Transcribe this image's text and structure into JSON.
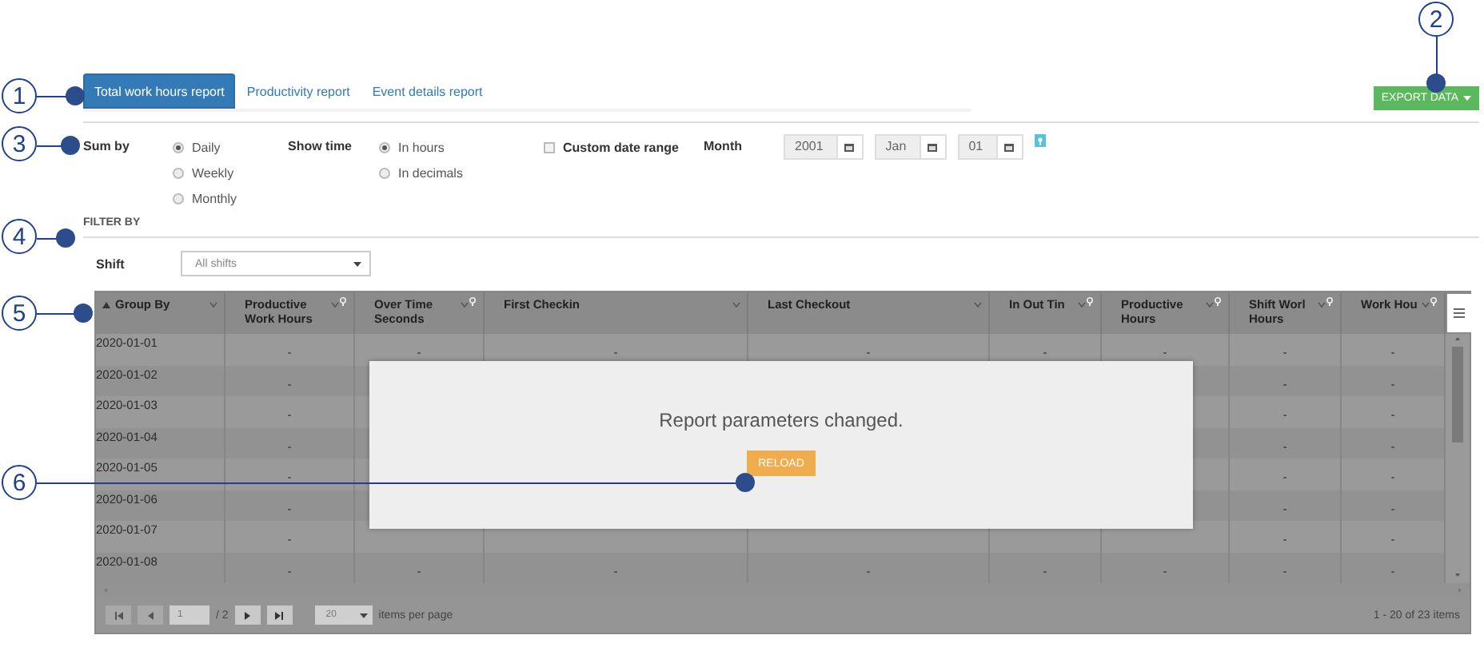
{
  "callouts": [
    {
      "label": "1"
    },
    {
      "label": "2"
    },
    {
      "label": "3"
    },
    {
      "label": "4"
    },
    {
      "label": "5"
    },
    {
      "label": "6"
    }
  ],
  "tabs": [
    {
      "label": "Total work hours report",
      "selected": true
    },
    {
      "label": "Productivity report",
      "selected": false
    },
    {
      "label": "Event details report",
      "selected": false
    }
  ],
  "export_button": {
    "label": "EXPORT DATA"
  },
  "options": {
    "sum_by": {
      "label": "Sum by",
      "choices": [
        {
          "label": "Daily",
          "selected": true
        },
        {
          "label": "Weekly",
          "selected": false
        },
        {
          "label": "Monthly",
          "selected": false
        }
      ]
    },
    "show_time": {
      "label": "Show time",
      "choices": [
        {
          "label": "In hours",
          "selected": true
        },
        {
          "label": "In decimals",
          "selected": false
        }
      ]
    },
    "custom_date_range": {
      "label": "Custom date range",
      "checked": false
    },
    "month": {
      "label": "Month",
      "fields": [
        {
          "value": "2001"
        },
        {
          "value": "Jan"
        },
        {
          "value": "01"
        }
      ]
    }
  },
  "filter": {
    "title": "FILTER BY",
    "shift": {
      "label": "Shift",
      "value": "All shifts"
    }
  },
  "table": {
    "columns": [
      {
        "label": "Group By",
        "sorted": true,
        "filter": false
      },
      {
        "label": "Productive Work Hours",
        "sorted": false,
        "filter": true
      },
      {
        "label": "Over Time Seconds",
        "sorted": false,
        "filter": true
      },
      {
        "label": "First Checkin",
        "sorted": false,
        "filter": false
      },
      {
        "label": "Last Checkout",
        "sorted": false,
        "filter": false
      },
      {
        "label": "In Out Tin",
        "sorted": false,
        "filter": true
      },
      {
        "label": "Productive Hours",
        "sorted": false,
        "filter": true
      },
      {
        "label": "Shift Worl Hours",
        "sorted": false,
        "filter": true
      },
      {
        "label": "Work Hou",
        "sorted": false,
        "filter": true
      }
    ],
    "rows": [
      {
        "cells": [
          "2020-01-01",
          "-",
          "-",
          "-",
          "-",
          "-",
          "-",
          "-",
          "-"
        ]
      },
      {
        "cells": [
          "2020-01-02",
          "-",
          null,
          null,
          null,
          null,
          null,
          "-",
          "-"
        ]
      },
      {
        "cells": [
          "2020-01-03",
          "-",
          null,
          null,
          null,
          null,
          null,
          "-",
          "-"
        ]
      },
      {
        "cells": [
          "2020-01-04",
          "-",
          null,
          null,
          null,
          null,
          null,
          "-",
          "-"
        ]
      },
      {
        "cells": [
          "2020-01-05",
          "-",
          null,
          null,
          null,
          null,
          null,
          "-",
          "-"
        ]
      },
      {
        "cells": [
          "2020-01-06",
          "-",
          null,
          null,
          null,
          null,
          null,
          "-",
          "-"
        ]
      },
      {
        "cells": [
          "2020-01-07",
          "-",
          null,
          null,
          null,
          null,
          null,
          "-",
          "-"
        ]
      },
      {
        "cells": [
          "2020-01-08",
          "-",
          "-",
          "-",
          "-",
          "-",
          "-",
          "-",
          "-"
        ]
      }
    ]
  },
  "pager": {
    "page": "1",
    "of": "/ 2",
    "page_size": "20",
    "page_size_label": "items per page",
    "summary": "1 - 20 of 23 items"
  },
  "dialog": {
    "message": "Report parameters changed.",
    "button": "RELOAD"
  }
}
